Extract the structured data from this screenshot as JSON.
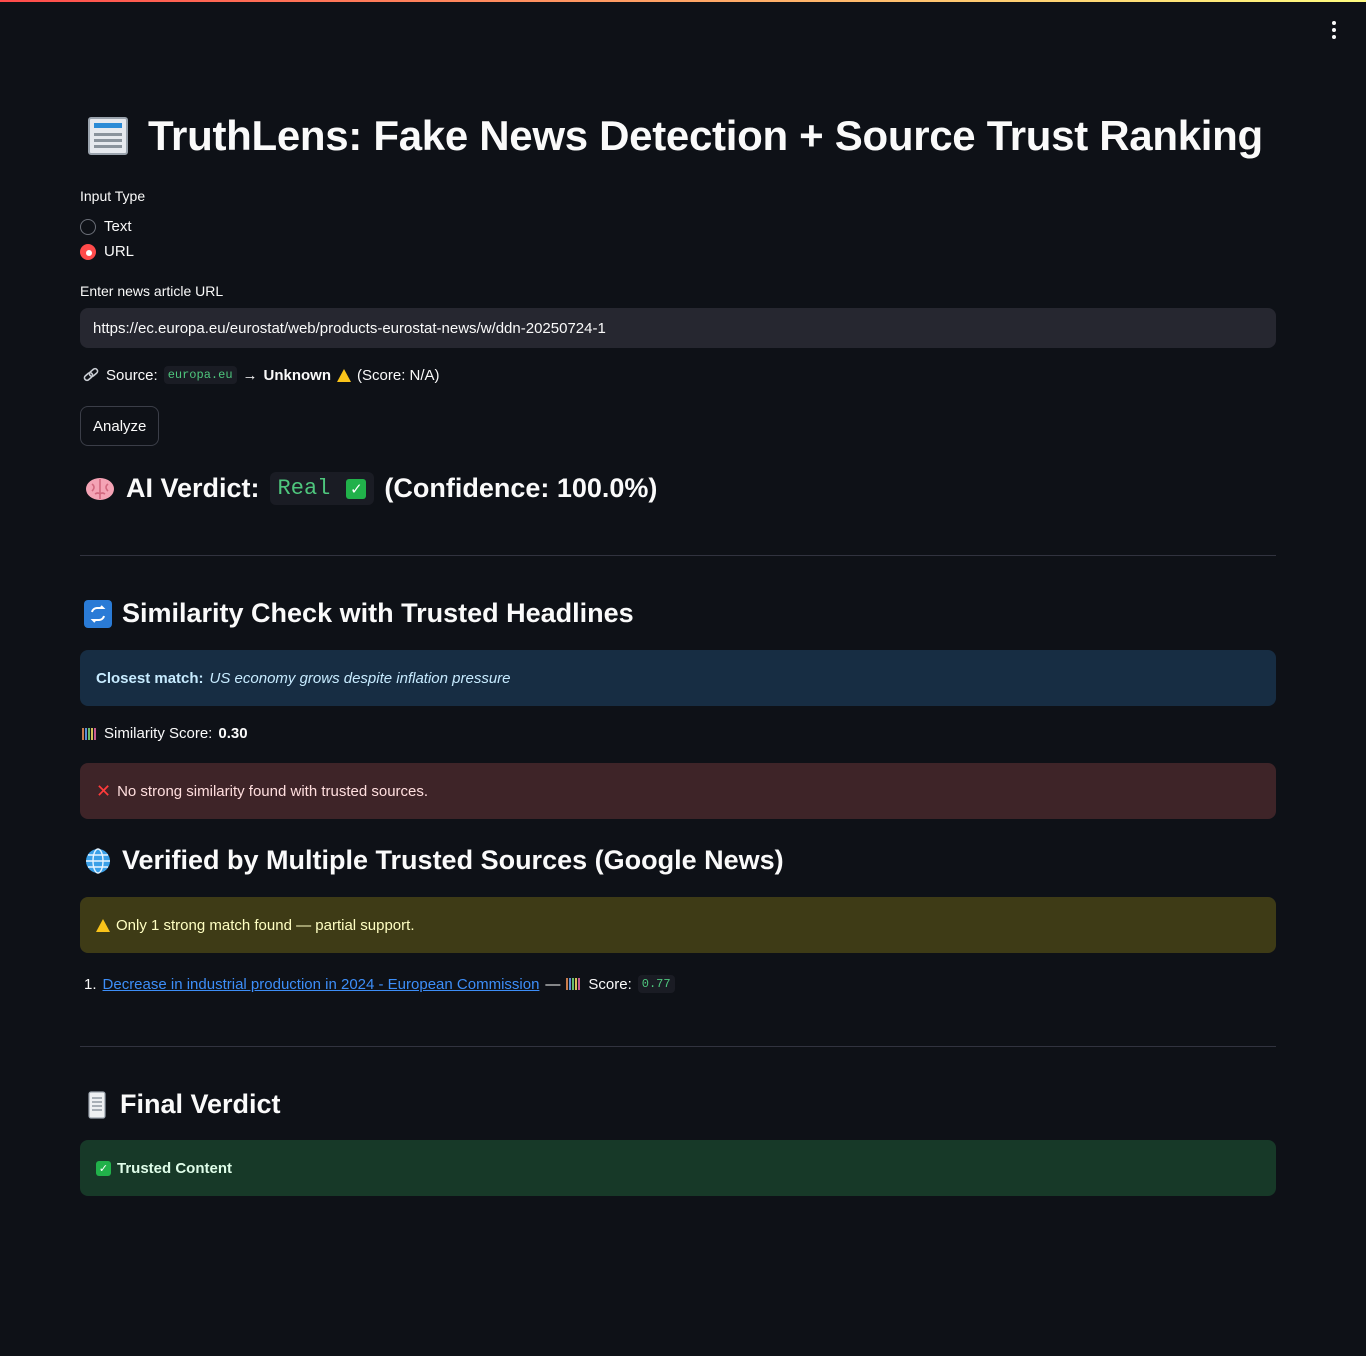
{
  "app": {
    "title": "TruthLens: Fake News Detection + Source Trust Ranking",
    "title_icon": "newspaper-icon"
  },
  "input_type": {
    "label": "Input Type",
    "options": [
      "Text",
      "URL"
    ],
    "selected": "URL"
  },
  "url_input": {
    "label": "Enter news article URL",
    "value": "https://ec.europa.eu/eurostat/web/products-eurostat-news/w/ddn-20250724-1"
  },
  "source": {
    "prefix": "Source:",
    "domain": "europa.eu",
    "arrow": "→",
    "trust_label": "Unknown",
    "score_text": "(Score: N/A)"
  },
  "analyze_button": {
    "label": "Analyze"
  },
  "ai_verdict": {
    "heading": "AI Verdict:",
    "verdict": "Real",
    "confidence_text": "(Confidence: 100.0%)"
  },
  "similarity": {
    "heading": "Similarity Check with Trusted Headlines",
    "closest_label": "Closest match:",
    "closest_text": "US economy grows despite inflation pressure",
    "score_label": "Similarity Score:",
    "score_value": "0.30",
    "error_text": "No strong similarity found with trusted sources."
  },
  "verified": {
    "heading": "Verified by Multiple Trusted Sources (Google News)",
    "warning_text": "Only 1 strong match found — partial support.",
    "results": [
      {
        "index": "1.",
        "title": "Decrease in industrial production in 2024 - European Commission",
        "dash": "—",
        "score_label": "Score:",
        "score": "0.77"
      }
    ]
  },
  "final_verdict": {
    "heading": "Final Verdict",
    "result": "Trusted Content"
  },
  "colors": {
    "background": "#0e1117",
    "accent": "#ff4b4b",
    "code_green": "#4ec67d",
    "link": "#3d8ef8"
  }
}
